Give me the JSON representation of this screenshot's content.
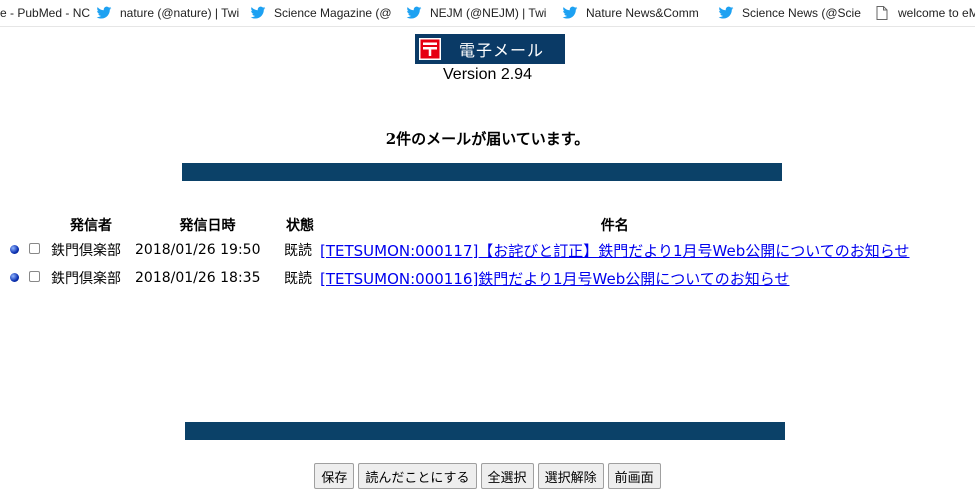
{
  "bookmarks": [
    {
      "label": "e - PubMed - NC",
      "icon": "document-icon"
    },
    {
      "label": "nature (@nature) | Twi",
      "icon": "twitter-icon"
    },
    {
      "label": "Science Magazine (@",
      "icon": "twitter-icon"
    },
    {
      "label": "NEJM (@NEJM) | Twi",
      "icon": "twitter-icon"
    },
    {
      "label": "Nature News&Comm",
      "icon": "twitter-icon"
    },
    {
      "label": "Science News (@Scie",
      "icon": "twitter-icon"
    },
    {
      "label": "welcome to eMerge",
      "icon": "document-icon"
    }
  ],
  "header": {
    "logo_text": "電子メール",
    "version": "Version 2.94",
    "notice": "2件のメールが届いています。"
  },
  "table": {
    "headers": {
      "sender": "発信者",
      "date": "発信日時",
      "status": "状態",
      "subject": "件名"
    },
    "rows": [
      {
        "sender": "鉄門倶楽部",
        "date": "2018/01/26 19:50",
        "status": "既読",
        "subject": "[TETSUMON:000117]【お詫びと訂正】鉄門だより1月号Web公開についてのお知らせ"
      },
      {
        "sender": "鉄門倶楽部",
        "date": "2018/01/26 18:35",
        "status": "既読",
        "subject": "[TETSUMON:000116]鉄門だより1月号Web公開についてのお知らせ"
      }
    ]
  },
  "buttons": {
    "save": "保存",
    "mark_read": "読んだことにする",
    "select_all": "全選択",
    "deselect": "選択解除",
    "back": "前画面"
  },
  "colors": {
    "bar": "#0b4168",
    "logo_bg": "#0a3a66",
    "link": "#0000ee",
    "twitter": "#1da1f2",
    "postal_red": "#e60012"
  }
}
